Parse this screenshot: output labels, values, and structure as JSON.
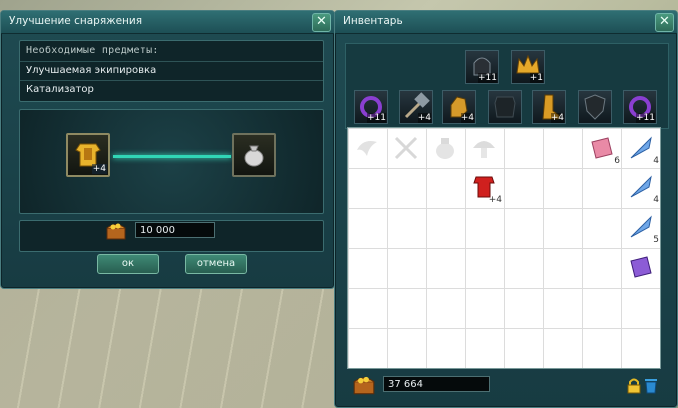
{
  "upgrade_window": {
    "title": "Улучшение снаряжения",
    "close_icon": "✕",
    "required_header": "Необходимые предметы:",
    "required_items": [
      "Улучшаемая экипировка",
      "Катализатор"
    ],
    "item_badge": "+4",
    "cost": "10 000",
    "ok_label": "ок",
    "cancel_label": "отмена"
  },
  "inventory_window": {
    "title": "Инвентарь",
    "close_icon": "✕",
    "equip_top": [
      {
        "icon": "helmet-icon",
        "badge": "+11"
      },
      {
        "icon": "crown-icon",
        "badge": "+1"
      }
    ],
    "equip_row": [
      {
        "icon": "ring-icon",
        "badge": "+11"
      },
      {
        "icon": "hammer-icon",
        "badge": "+4"
      },
      {
        "icon": "gauntlet-icon",
        "badge": "+4"
      },
      {
        "icon": "armor-icon",
        "badge": ""
      },
      {
        "icon": "boot-icon",
        "badge": "+4"
      },
      {
        "icon": "shield-icon",
        "badge": ""
      },
      {
        "icon": "ring-icon",
        "badge": "+11"
      }
    ],
    "items": [
      {
        "icon": "wing-icon",
        "badge": ""
      },
      {
        "icon": "crossed-swords-icon",
        "badge": ""
      },
      {
        "icon": "bag-icon",
        "badge": ""
      },
      {
        "icon": "mushroom-icon",
        "badge": ""
      },
      {
        "icon": "pink-book-icon",
        "badge": "6"
      },
      {
        "icon": "feather-icon",
        "badge": "4"
      },
      {
        "icon": "armor-red-icon",
        "badge": "+4"
      },
      {
        "icon": "feather-icon",
        "badge": "4"
      },
      {
        "icon": "feather-icon",
        "badge": "5"
      },
      {
        "icon": "purple-book-icon",
        "badge": ""
      }
    ],
    "gold": "37 664",
    "lock_icon": "lock-icon",
    "trash_icon": "trash-icon"
  },
  "colors": {
    "accent": "#31d6b6",
    "window": "#1f4b52",
    "gold": "#e8b32c"
  }
}
